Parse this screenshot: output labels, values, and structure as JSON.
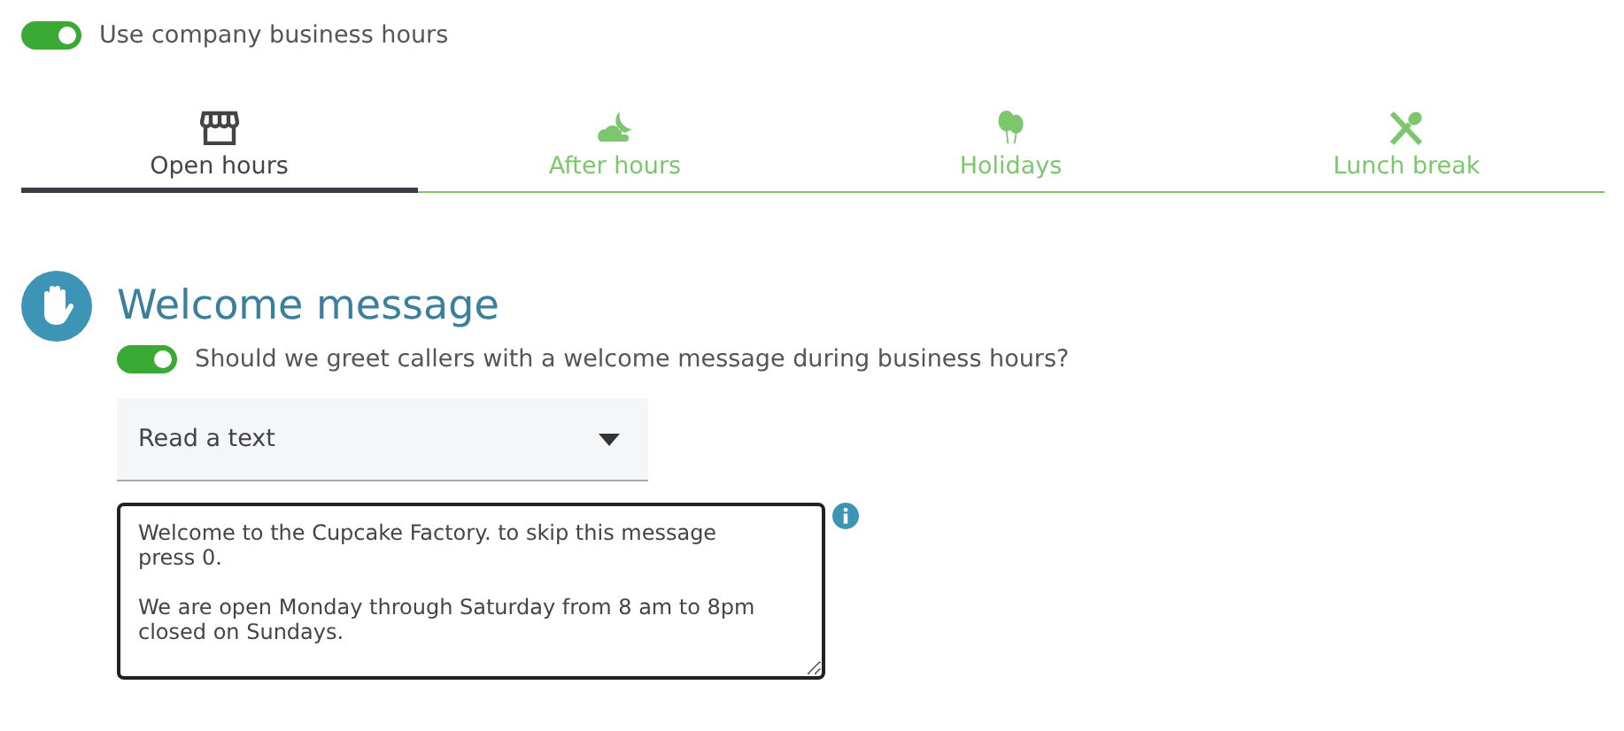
{
  "company_hours": {
    "label": "Use company business hours",
    "on": true
  },
  "tabs": [
    {
      "label": "Open hours",
      "kind": "store",
      "selected": true
    },
    {
      "label": "After hours",
      "kind": "moon",
      "selected": false
    },
    {
      "label": "Holidays",
      "kind": "balloons",
      "selected": false
    },
    {
      "label": "Lunch break",
      "kind": "utensils",
      "selected": false
    }
  ],
  "section": {
    "title": "Welcome message",
    "greeting": {
      "label": "Should we greet callers with a welcome message during business hours?",
      "on": true
    },
    "mode": {
      "value": "Read a text"
    },
    "message": {
      "value": "Welcome to the Cupcake Factory. to skip this message\npress 0.\n\nWe are open Monday through Saturday from 8 am to 8pm\nclosed on Sundays."
    }
  }
}
